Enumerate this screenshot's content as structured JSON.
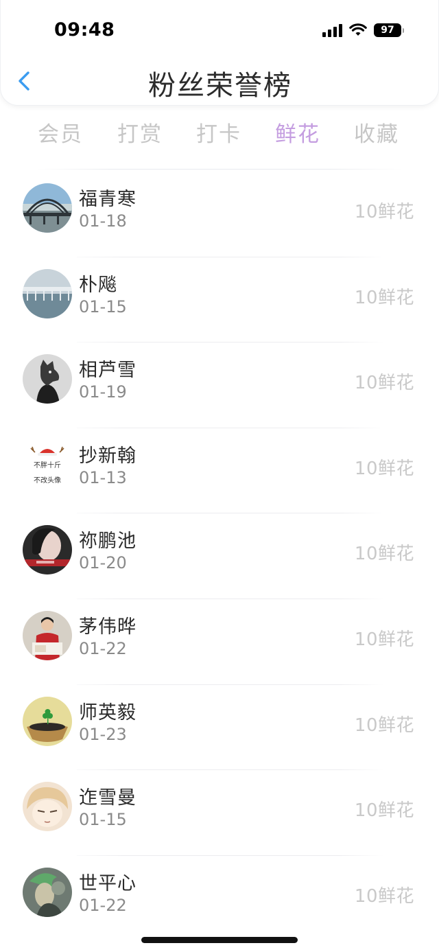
{
  "status_bar": {
    "time": "09:48",
    "battery": "97"
  },
  "header": {
    "title": "粉丝荣誉榜"
  },
  "tabs": [
    {
      "label": "会员",
      "active": false
    },
    {
      "label": "打赏",
      "active": false
    },
    {
      "label": "打卡",
      "active": false
    },
    {
      "label": "鲜花",
      "active": true
    },
    {
      "label": "收藏",
      "active": false
    }
  ],
  "colors": {
    "accent": "#c49de0",
    "back_arrow": "#3b9cf0"
  },
  "entries": [
    {
      "name": "福青寒",
      "date": "01-18",
      "amount": "10鲜花",
      "avatar": "bridge-photo"
    },
    {
      "name": "朴飚",
      "date": "01-15",
      "amount": "10鲜花",
      "avatar": "sea-bridge-photo"
    },
    {
      "name": "相芦雪",
      "date": "01-19",
      "amount": "10鲜花",
      "avatar": "wolf-mask-figure"
    },
    {
      "name": "抄新翰",
      "date": "01-13",
      "amount": "10鲜花",
      "avatar": "text-badge",
      "avatar_text_1": "不胖十斤",
      "avatar_text_2": "不改头像"
    },
    {
      "name": "祢鹏池",
      "date": "01-20",
      "amount": "10鲜花",
      "avatar": "portrait-woman"
    },
    {
      "name": "茅伟晔",
      "date": "01-22",
      "amount": "10鲜花",
      "avatar": "student-certificate"
    },
    {
      "name": "师英毅",
      "date": "01-23",
      "amount": "10鲜花",
      "avatar": "clover-bowl"
    },
    {
      "name": "迮雪曼",
      "date": "01-15",
      "amount": "10鲜花",
      "avatar": "anime-face"
    },
    {
      "name": "世平心",
      "date": "01-22",
      "amount": "10鲜花",
      "avatar": "fantasy-figure"
    }
  ]
}
